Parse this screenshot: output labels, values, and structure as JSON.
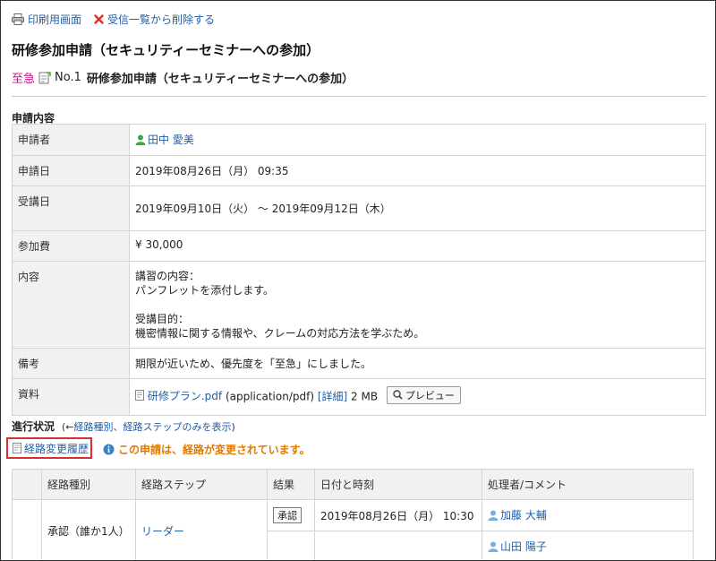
{
  "toolbar": {
    "print_label": "印刷用画面",
    "delete_label": "受信一覧から削除する"
  },
  "page_title": "研修参加申請（セキュリティーセミナーへの参加）",
  "subheading": {
    "priority": "至急",
    "number": "No.1",
    "title": "研修参加申請（セキュリティーセミナーへの参加）"
  },
  "section_request": "申請内容",
  "details": {
    "applicant": {
      "label": "申請者",
      "value": "田中 愛美"
    },
    "date": {
      "label": "申請日",
      "value": "2019年08月26日（月） 09:35"
    },
    "course_date": {
      "label": "受講日",
      "value": "2019年09月10日（火） 〜 2019年09月12日（木）"
    },
    "fee": {
      "label": "参加費",
      "value": "¥ 30,000"
    },
    "content": {
      "label": "内容",
      "lines": [
        "講習の内容：",
        "パンフレットを添付します。",
        "",
        "受講目的：",
        "機密情報に関する情報や、クレームの対応方法を学ぶため。"
      ]
    },
    "remarks": {
      "label": "備考",
      "value": "期限が近いため、優先度を「至急」にしました。"
    },
    "attachment": {
      "label": "資料",
      "file_name": "研修プラン.pdf",
      "file_type": "(application/pdf)",
      "detail_link": "[詳細]",
      "size": "2 MB",
      "preview_label": "プレビュー"
    }
  },
  "progress": {
    "label": "進行状況",
    "toggle_prefix": "(←",
    "toggle_link": "経路種別、経路ステップのみを表示",
    "toggle_suffix": ")"
  },
  "history_link": "経路変更履歴",
  "notice": "この申請は、経路が変更されています。",
  "route_table": {
    "headers": [
      "経路種別",
      "経路ステップ",
      "結果",
      "日付と時刻",
      "処理者/コメント"
    ],
    "type": "承認（誰か1人）",
    "step": "リーダー",
    "rows": [
      {
        "result": "承認",
        "datetime": "2019年08月26日（月） 10:30",
        "handler": "加藤 大輔"
      },
      {
        "result": "",
        "datetime": "",
        "handler": "山田 陽子"
      }
    ]
  }
}
